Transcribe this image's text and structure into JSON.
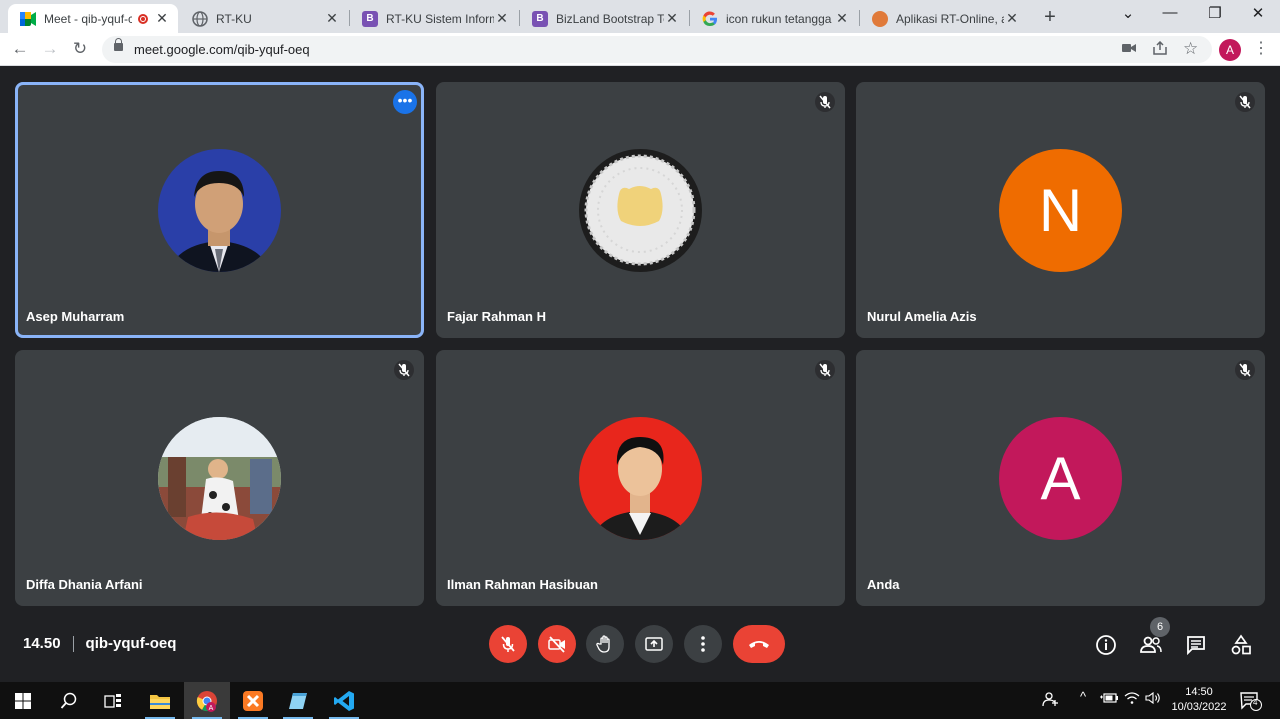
{
  "browser": {
    "tabs": [
      {
        "title": "Meet - qib-yquf-c",
        "active": true,
        "icon": "google-meet-icon",
        "recording": true
      },
      {
        "title": "RT-KU",
        "active": false,
        "icon": "globe-icon"
      },
      {
        "title": "RT-KU Sistem Informa",
        "active": false,
        "icon": "bootstrap-icon"
      },
      {
        "title": "BizLand Bootstrap Ten",
        "active": false,
        "icon": "bootstrap-icon"
      },
      {
        "title": "icon rukun tetangga -",
        "active": false,
        "icon": "google-icon"
      },
      {
        "title": "Aplikasi RT-Online, ap",
        "active": false,
        "icon": "site-icon"
      }
    ],
    "new_tab": "+",
    "url": "meet.google.com/qib-yquf-oeq",
    "profile_initial": "A",
    "profile_color": "#c2185b"
  },
  "meet": {
    "participants": [
      {
        "name": "Asep Muharram",
        "avatar": "photo",
        "speaking": true,
        "muted": false
      },
      {
        "name": "Fajar Rahman H",
        "avatar": "photo",
        "speaking": false,
        "muted": true
      },
      {
        "name": "Nurul Amelia Azis",
        "avatar_letter": "N",
        "avatar_color": "#ef6c00",
        "muted": true
      },
      {
        "name": "Diffa Dhania Arfani",
        "avatar": "photo",
        "muted": true
      },
      {
        "name": "Ilman Rahman Hasibuan",
        "avatar": "photo",
        "muted": true
      },
      {
        "name": "Anda",
        "avatar_letter": "A",
        "avatar_color": "#c2185b",
        "muted": true
      }
    ],
    "time": "14.50",
    "meeting_code": "qib-yquf-oeq",
    "participant_count": "6",
    "controls": [
      "mic-off-icon",
      "camera-off-icon",
      "raise-hand-icon",
      "present-screen-icon",
      "more-options-icon",
      "end-call-icon"
    ],
    "right_controls": [
      "info-icon",
      "people-icon",
      "chat-icon",
      "activities-icon"
    ]
  },
  "taskbar": {
    "apps": [
      "windows-start-icon",
      "search-icon",
      "task-view-icon",
      "file-explorer-icon",
      "chrome-icon",
      "xampp-icon",
      "notepad-icon",
      "vscode-icon"
    ],
    "clock_time": "14:50",
    "clock_date": "10/03/2022",
    "notification_count": "4"
  },
  "colors": {
    "meet_bg": "#202124",
    "tile_bg": "#3c4043",
    "speaking_outline": "#8ab4f8",
    "end_call_red": "#ea4335"
  }
}
